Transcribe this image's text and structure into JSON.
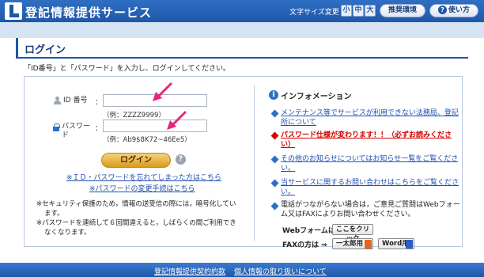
{
  "header": {
    "title": "登記情報提供サービス",
    "font_size_label": "文字サイズ変更",
    "font_size_small": "小",
    "font_size_medium": "中",
    "font_size_large": "大",
    "recommended_env": "推奨環境",
    "help": "使い方",
    "help_badge": "?"
  },
  "page": {
    "title": "ログイン",
    "instruction": "「ID番号」と「パスワード」を入力し、ログインしてください。"
  },
  "form": {
    "id_label": "ID 番号",
    "id_colon": "：",
    "id_value": "",
    "id_example": "（例：ZZZZ9999）",
    "password_label_line1": "パスワー",
    "password_label_line2": "ド",
    "password_colon": "：",
    "password_value": "",
    "password_example": "（例：Ab9$8K72~46Ee5）",
    "login_button": "ログイン",
    "help_icon": "?",
    "forgot_link": "※ＩＤ・パスワードを忘れてしまった方はこちら",
    "change_password_link": "※パスワードの変更手続はこちら",
    "note_security_line1": "※セキュリティ保護のため，情報の送受信の際には，暗号化してい",
    "note_security_line2": "ます。",
    "note_lockout_line1": "※パスワードを連続して６回間違えると，しばらくの間ご利用でき",
    "note_lockout_line2": "なくなります。"
  },
  "info": {
    "title": "インフォメーション",
    "icon": "i",
    "items": [
      {
        "line1": "メンテナンス等でサービスが利用できない法務局、登記",
        "line2": "所について",
        "color": "#1f4fb0",
        "bullet_color": "#2f6fc4"
      },
      {
        "line1": "パスワード仕様が変わります！！（必ずお読みくださ",
        "line2": "い）",
        "color": "#d40000",
        "bullet_color": "#d40000"
      },
      {
        "line1": "その他のお知らせについてはお知らせ一覧をご覧くださ",
        "line2": "い。",
        "color": "#1f4fb0",
        "bullet_color": "#2f6fc4"
      },
      {
        "line1": "当サービスに関するお問い合わせはこちらをご覧くださ",
        "line2": "い。",
        "color": "#1f4fb0",
        "bullet_color": "#2f6fc4"
      }
    ],
    "contact_line1": "電話がつながらない場合は，ご意見ご質問はWebフォー",
    "contact_line2": "ム又はFAXによりお問い合わせください。",
    "web_form_label": "Webフォームは",
    "web_form_button": "ここをクリック",
    "fax_label": "FAXの方は ⇒",
    "fax_ichitaro": "一太郎用",
    "fax_word": "Word用"
  },
  "footer": {
    "terms_link": "登記情報提供契約約款",
    "privacy_link": "個人情報の取り扱いについて"
  },
  "colors": {
    "header_blue": "#1f57a8",
    "link_blue": "#1f4fb0",
    "alert_red": "#d40000",
    "annotation_pink": "#e8237a",
    "login_gold": "#e0a42a"
  }
}
